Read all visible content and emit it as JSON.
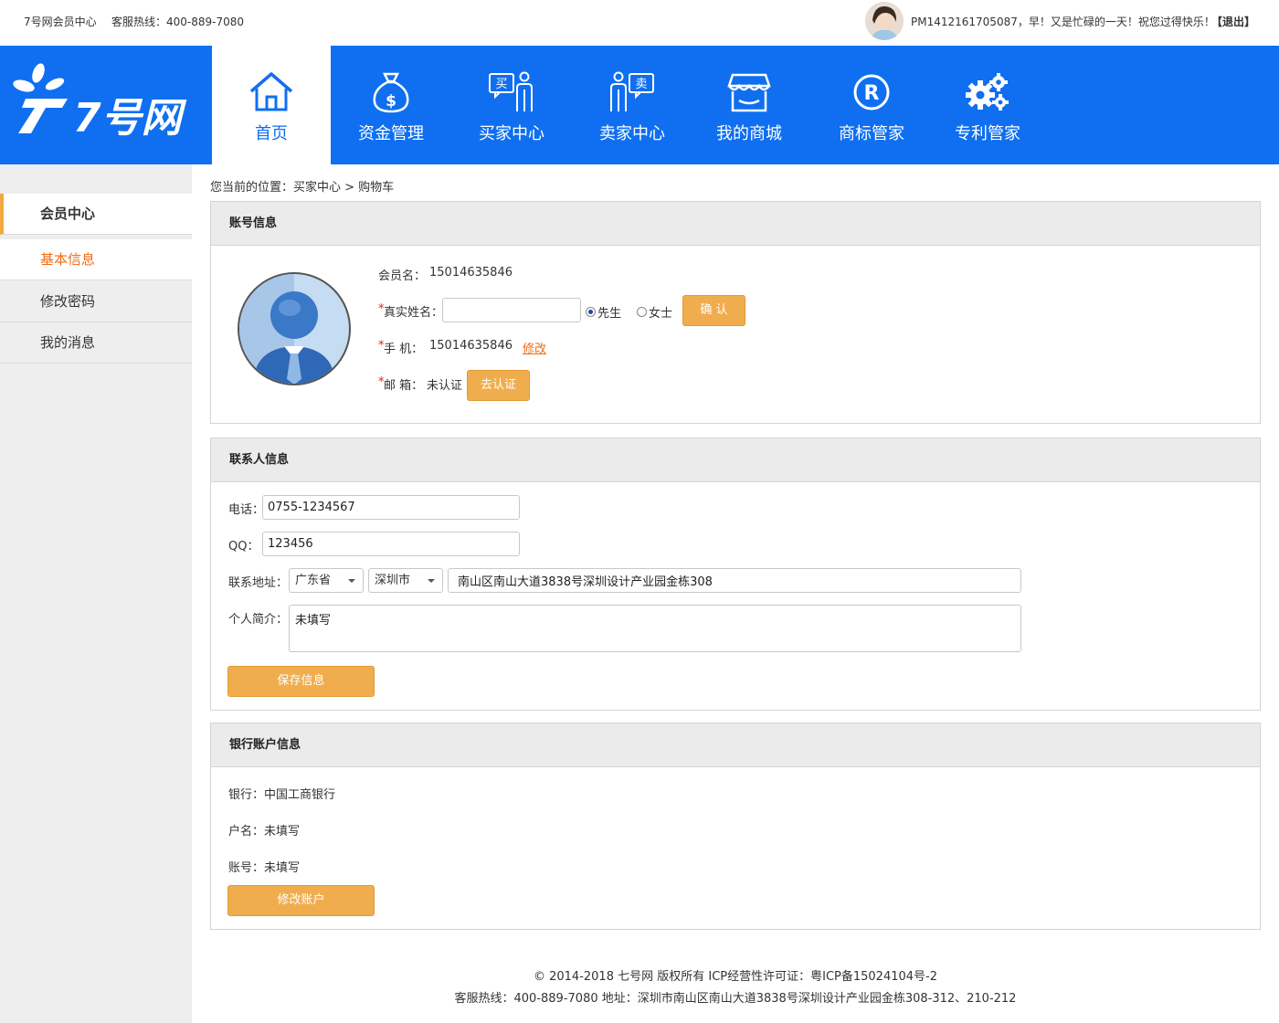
{
  "topbar": {
    "site_name": "7号网会员中心",
    "hotline": "客服热线：400-889-7080",
    "greeting": "PM1412161705087，早！又是忙碌的一天！祝您过得快乐！",
    "logout": "【退出】"
  },
  "brand": {
    "logo_text": "7号网",
    "primary_color": "#0f6ff0",
    "accent_color": "#f0ad4e"
  },
  "nav": {
    "items": [
      {
        "label": "首页",
        "icon": "home-icon",
        "active": true
      },
      {
        "label": "资金管理",
        "icon": "money-bag-icon"
      },
      {
        "label": "买家中心",
        "icon": "buyer-icon"
      },
      {
        "label": "卖家中心",
        "icon": "seller-icon"
      },
      {
        "label": "我的商城",
        "icon": "store-icon"
      },
      {
        "label": "商标管家",
        "icon": "registered-icon"
      },
      {
        "label": "专利管家",
        "icon": "gears-icon"
      }
    ],
    "buy_char": "买",
    "sell_char": "卖"
  },
  "sidebar": {
    "title": "会员中心",
    "items": [
      "基本信息",
      "修改密码",
      "我的消息"
    ]
  },
  "breadcrumb": "您当前的位置：买家中心 >  购物车",
  "account": {
    "title": "账号信息",
    "member_label": "会员名：",
    "member_value": "15014635846",
    "realname_label": "真实姓名：",
    "realname_value": "",
    "gender_options": [
      "先生",
      "女士"
    ],
    "gender_selected": "先生",
    "confirm_button": "确 认",
    "phone_label": "手  机：",
    "phone_value": "15014635846",
    "modify_link": "修改",
    "email_label": "邮  箱：",
    "email_value": "未认证",
    "verify_button": "去认证",
    "required_mark": "*"
  },
  "contact": {
    "title": "联系人信息",
    "tel_label": "电话：",
    "tel_value": "0755-1234567",
    "qq_label": "QQ：",
    "qq_value": "123456",
    "address_label": "联系地址：",
    "province": "广东省",
    "city": "深圳市",
    "address_value": "南山区南山大道3838号深圳设计产业园金栋308",
    "intro_label": "个人简介：",
    "intro_value": "未填写",
    "save_button": "保存信息"
  },
  "bank": {
    "title": "银行账户信息",
    "bank_line": "银行：中国工商银行",
    "name_line": "户名：未填写",
    "account_line": "账号：未填写",
    "modify_button": "修改账户"
  },
  "footer": {
    "line1": "© 2014-2018 七号网 版权所有 ICP经营性许可证：粤ICP备15024104号-2",
    "line2": "客服热线：400-889-7080  地址：深圳市南山区南山大道3838号深圳设计产业园金栋308-312、210-212"
  }
}
